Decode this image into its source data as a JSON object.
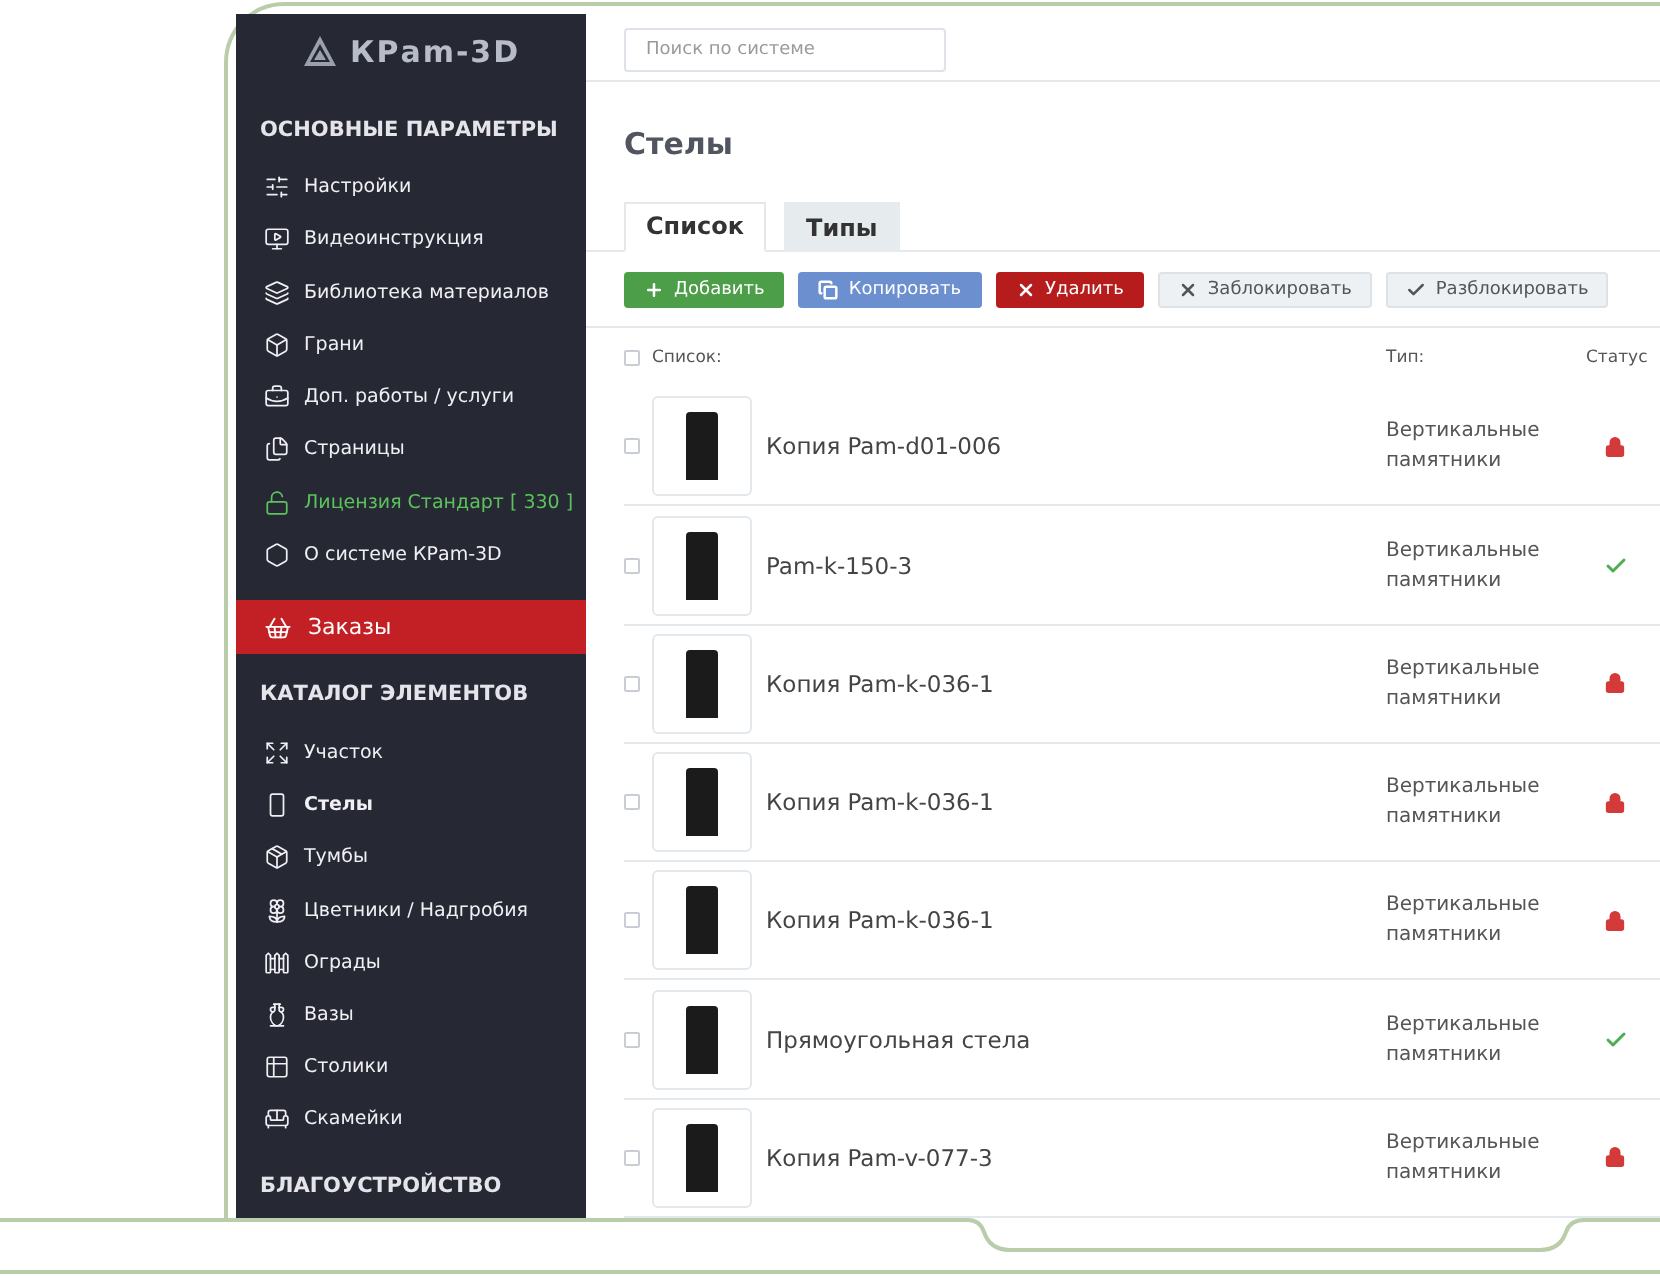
{
  "sidebar": {
    "logo": "КРam-3D",
    "sections": [
      {
        "title": "ОСНОВНЫЕ ПАРАМЕТРЫ",
        "items": [
          {
            "label": "Настройки",
            "kind": "link",
            "selected": false
          },
          {
            "label": "Видеоинструкция",
            "kind": "link",
            "selected": false
          },
          {
            "label": "Библиотека материалов",
            "kind": "link",
            "selected": false
          },
          {
            "label": "Грани",
            "kind": "link",
            "selected": false
          },
          {
            "label": "Доп. работы / услуги",
            "kind": "link",
            "selected": false
          },
          {
            "label": "Страницы",
            "kind": "link",
            "selected": false
          },
          {
            "label": "Лицензия Стандарт [ 330 ]",
            "kind": "license",
            "selected": false
          },
          {
            "label": "О системе КРam-3D",
            "kind": "link",
            "selected": false
          }
        ],
        "accent": {
          "label": "Заказы"
        }
      },
      {
        "title": "КАТАЛОГ ЭЛЕМЕНТОВ",
        "items": [
          {
            "label": "Участок",
            "kind": "link",
            "selected": false
          },
          {
            "label": "Стелы",
            "kind": "link",
            "selected": true
          },
          {
            "label": "Тумбы",
            "kind": "link",
            "selected": false
          },
          {
            "label": "Цветники / Надгробия",
            "kind": "link",
            "selected": false
          },
          {
            "label": "Ограды",
            "kind": "link",
            "selected": false
          },
          {
            "label": "Вазы",
            "kind": "link",
            "selected": false
          },
          {
            "label": "Столики",
            "kind": "link",
            "selected": false
          },
          {
            "label": "Скамейки",
            "kind": "link",
            "selected": false
          }
        ]
      },
      {
        "title": "БЛАГОУСТРОЙСТВО"
      }
    ]
  },
  "search": {
    "placeholder": "Поиск по системе"
  },
  "page_title": "Стелы",
  "tabs": [
    {
      "label": "Список",
      "selected": true
    },
    {
      "label": "Типы",
      "selected": false
    }
  ],
  "actions": [
    {
      "label": "Добавить",
      "kind": "add"
    },
    {
      "label": "Копировать",
      "kind": "copy"
    },
    {
      "label": "Удалить",
      "kind": "delete"
    },
    {
      "label": "Заблокировать",
      "kind": "lock"
    },
    {
      "label": "Разблокировать",
      "kind": "unlock"
    }
  ],
  "table": {
    "select_all": {
      "checked": false
    },
    "columns": [
      "Список:",
      "Тип:",
      "Статус"
    ],
    "rows": [
      {
        "name": "Копия Pam-d01-006",
        "type": "Вертикальные памятники",
        "locked": true,
        "checked": false
      },
      {
        "name": "Pam-k-150-3",
        "type": "Вертикальные памятники",
        "locked": false,
        "checked": false
      },
      {
        "name": "Копия Pam-k-036-1",
        "type": "Вертикальные памятники",
        "locked": true,
        "checked": false
      },
      {
        "name": "Копия Pam-k-036-1",
        "type": "Вертикальные памятники",
        "locked": true,
        "checked": false
      },
      {
        "name": "Копия Pam-k-036-1",
        "type": "Вертикальные памятники",
        "locked": true,
        "checked": false
      },
      {
        "name": "Прямоугольная стела",
        "type": "Вертикальные памятники",
        "locked": false,
        "checked": false
      },
      {
        "name": "Копия Pam-v-077-3",
        "type": "Вертикальные памятники",
        "locked": true,
        "checked": false
      }
    ]
  }
}
